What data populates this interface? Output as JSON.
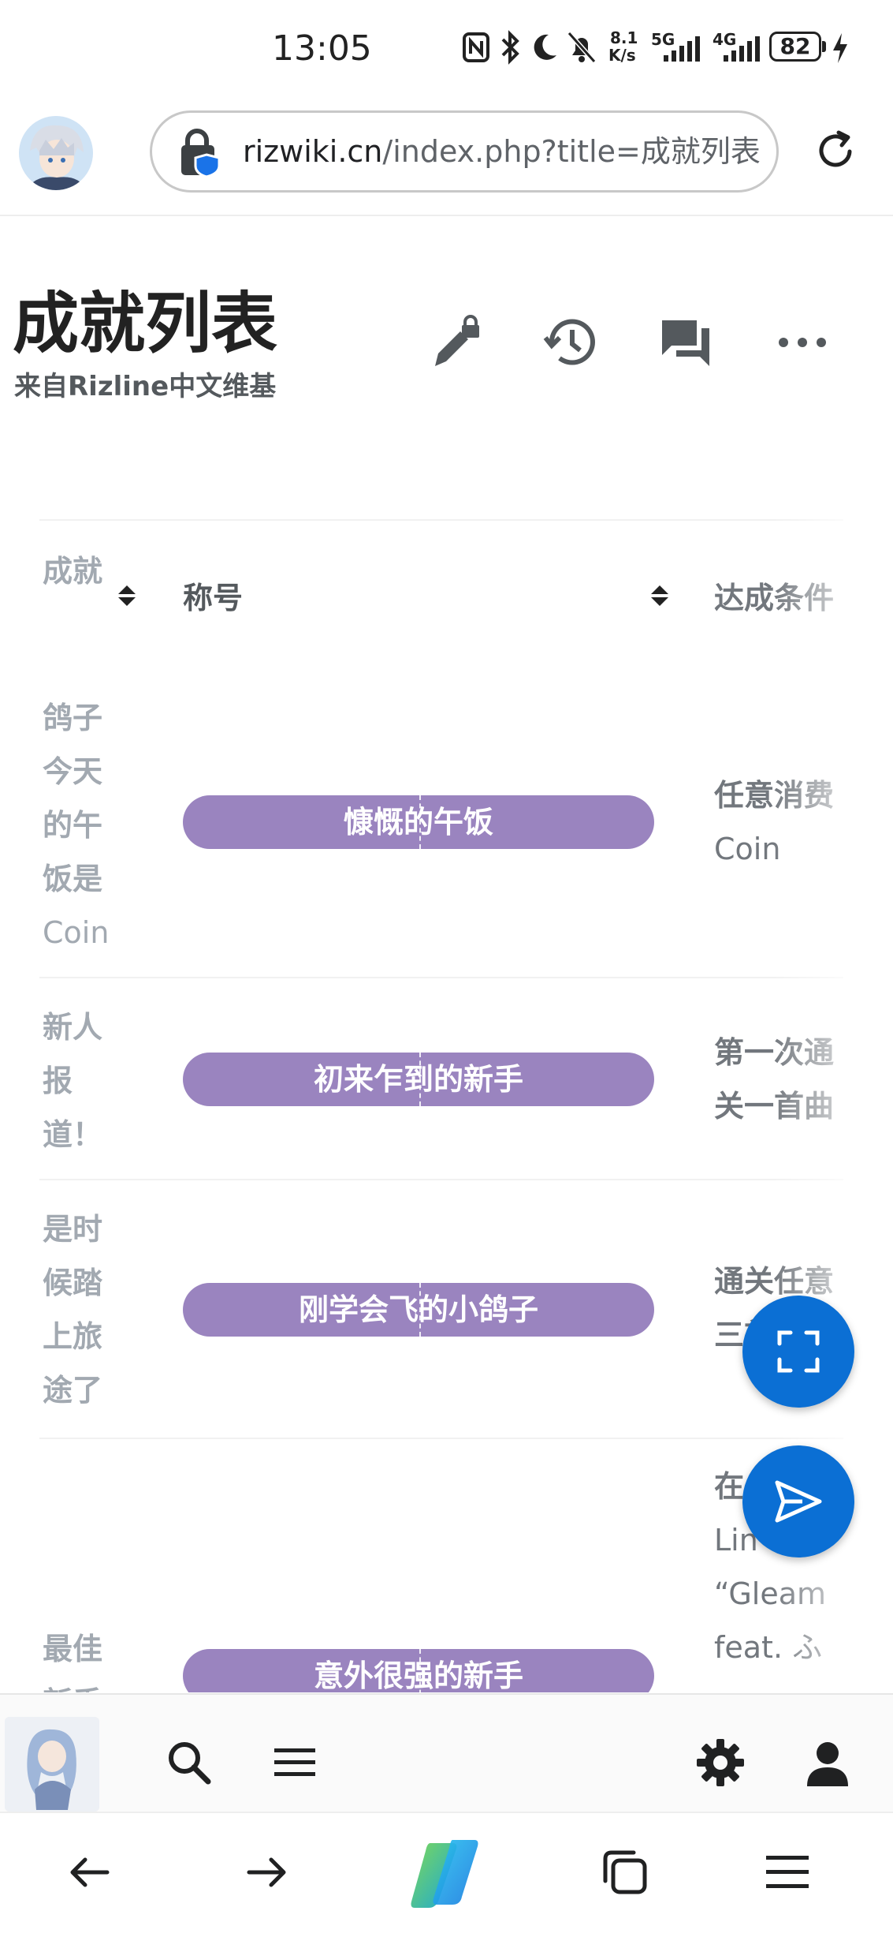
{
  "status_bar": {
    "time": "13:05",
    "network_speed_value": "8.1",
    "network_speed_unit": "K/s",
    "net1": "5G",
    "net2": "4G",
    "battery": "82",
    "icons": [
      "nfc-icon",
      "bluetooth-icon",
      "moon-icon",
      "bell-off-icon",
      "signal-icon",
      "charging-icon"
    ]
  },
  "browser": {
    "url_domain": "rizwiki.cn",
    "url_path": "/index.php?title=成就列表"
  },
  "page": {
    "title": "成就列表",
    "subtitle": "来自Rizline中文维基"
  },
  "table": {
    "headers": {
      "achievement": "成就",
      "title": "称号",
      "condition": "达成条件"
    },
    "rows": [
      {
        "achievement_cjk": "鸽子今天的午饭是",
        "achievement_latin": "Coin",
        "title": "慷慨的午饭",
        "condition_cjk": "任意消费",
        "condition_latin": "Coin"
      },
      {
        "achievement_cjk": "新人报道！",
        "achievement_latin": "",
        "title": "初来乍到的新手",
        "condition_cjk": "第一次通关一首曲",
        "condition_latin": ""
      },
      {
        "achievement_cjk": "是时候踏上旅途了",
        "achievement_latin": "",
        "title": "刚学会飞的小鸽子",
        "condition_cjk": "通关任意三首",
        "condition_latin": ""
      },
      {
        "achievement_cjk": "最佳新手",
        "achievement_latin": "",
        "title": "意外很强的新手",
        "condition_cjk": "在",
        "condition_latin": "Lin",
        "condition_extra_1": "“Gleam",
        "condition_extra_2": "feat. ふ"
      }
    ]
  },
  "colors": {
    "pill": "#9a84bf",
    "fab": "#0b6fd4",
    "muted_text": "#a2a9b1",
    "condition_text": "#72777d"
  }
}
